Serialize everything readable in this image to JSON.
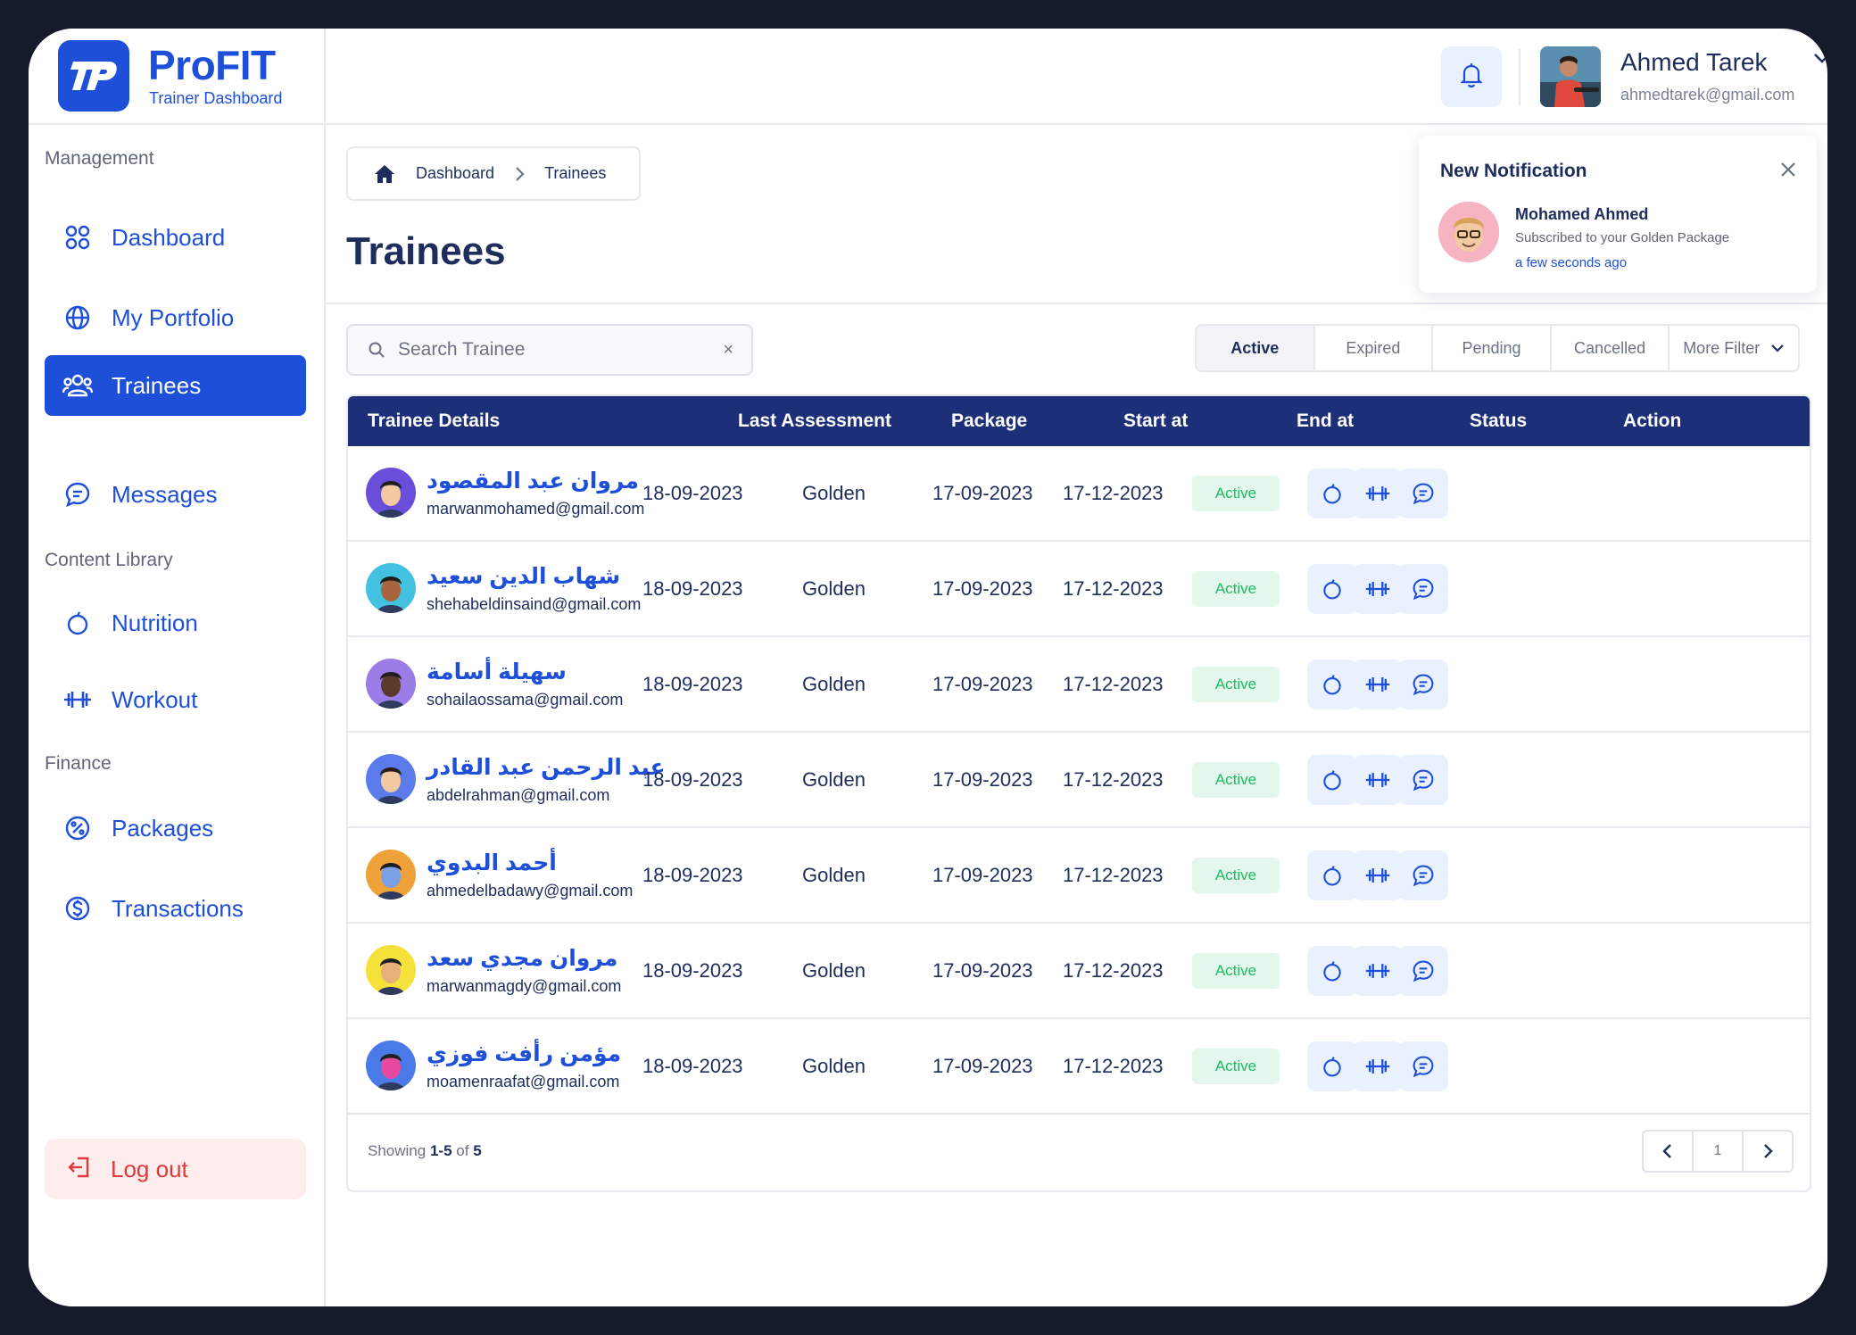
{
  "brand": {
    "title": "ProFIT",
    "subtitle": "Trainer Dashboard"
  },
  "sidebar": {
    "sections": [
      {
        "label": "Management"
      },
      {
        "label": "Content Library"
      },
      {
        "label": "Finance"
      }
    ],
    "items": [
      {
        "label": "Dashboard",
        "icon": "grid-icon"
      },
      {
        "label": "My Portfolio",
        "icon": "globe-icon"
      },
      {
        "label": "Trainees",
        "icon": "users-icon",
        "active": true
      },
      {
        "label": "Messages",
        "icon": "message-icon"
      },
      {
        "label": "Nutrition",
        "icon": "apple-icon"
      },
      {
        "label": "Workout",
        "icon": "dumbbell-icon"
      },
      {
        "label": "Packages",
        "icon": "percent-icon"
      },
      {
        "label": "Transactions",
        "icon": "dollar-icon"
      }
    ],
    "logout": "Log out"
  },
  "header": {
    "user_name": "Ahmed Tarek",
    "user_email": "ahmedtarek@gmail.com"
  },
  "breadcrumb": {
    "home": "Dashboard",
    "current": "Trainees"
  },
  "page_title": "Trainees",
  "notification": {
    "title": "New Notification",
    "name": "Mohamed Ahmed",
    "message": "Subscribed to your Golden Package",
    "time": "a few seconds ago"
  },
  "search": {
    "placeholder": "Search Trainee",
    "clear": "×"
  },
  "filters": [
    "Active",
    "Expired",
    "Pending",
    "Cancelled",
    "More Filter"
  ],
  "table": {
    "columns": [
      "Trainee Details",
      "Last Assessment",
      "Package",
      "Start at",
      "End at",
      "Status",
      "Action"
    ],
    "rows": [
      {
        "name": "مروان عبد المقصود",
        "email": "marwanmohamed@gmail.com",
        "last": "18-09-2023",
        "package": "Golden",
        "start": "17-09-2023",
        "end": "17-12-2023",
        "status": "Active"
      },
      {
        "name": "شهاب الدين سعيد",
        "email": "shehabeldinsaind@gmail.com",
        "last": "18-09-2023",
        "package": "Golden",
        "start": "17-09-2023",
        "end": "17-12-2023",
        "status": "Active"
      },
      {
        "name": "سهيلة أسامة",
        "email": "sohailaossama@gmail.com",
        "last": "18-09-2023",
        "package": "Golden",
        "start": "17-09-2023",
        "end": "17-12-2023",
        "status": "Active"
      },
      {
        "name": "عبد الرحمن عبد القادر",
        "email": "abdelrahman@gmail.com",
        "last": "18-09-2023",
        "package": "Golden",
        "start": "17-09-2023",
        "end": "17-12-2023",
        "status": "Active"
      },
      {
        "name": "أحمد البدوي",
        "email": "ahmedelbadawy@gmail.com",
        "last": "18-09-2023",
        "package": "Golden",
        "start": "17-09-2023",
        "end": "17-12-2023",
        "status": "Active"
      },
      {
        "name": "مروان مجدي سعد",
        "email": "marwanmagdy@gmail.com",
        "last": "18-09-2023",
        "package": "Golden",
        "start": "17-09-2023",
        "end": "17-12-2023",
        "status": "Active"
      },
      {
        "name": "مؤمن رأفت فوزي",
        "email": "moamenraafat@gmail.com",
        "last": "18-09-2023",
        "package": "Golden",
        "start": "17-09-2023",
        "end": "17-12-2023",
        "status": "Active"
      }
    ]
  },
  "footer": {
    "showing_prefix": "Showing",
    "showing_range": "1-5",
    "showing_of": "of",
    "showing_total": "5"
  },
  "pagination": {
    "page": "1"
  },
  "colors": {
    "primary": "#1e4fd8",
    "header_navy": "#1e2f7a",
    "active_green": "#22b865",
    "danger": "#e0393e"
  }
}
